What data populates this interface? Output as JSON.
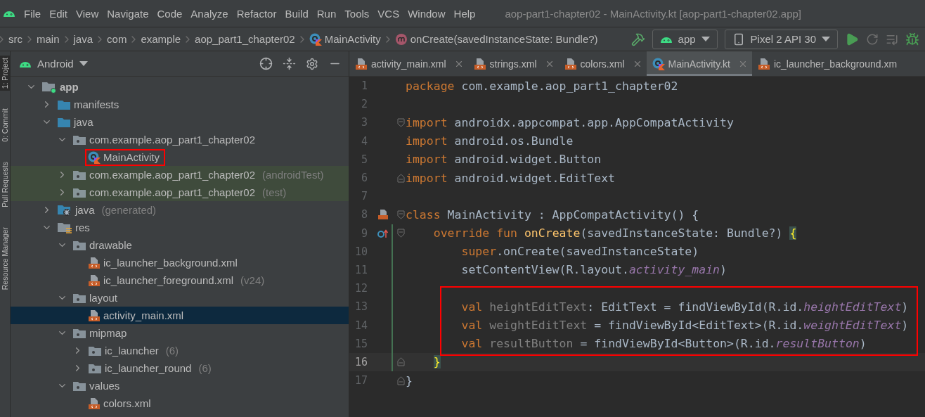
{
  "menu_bar": {
    "items": [
      "File",
      "Edit",
      "View",
      "Navigate",
      "Code",
      "Analyze",
      "Refactor",
      "Build",
      "Run",
      "Tools",
      "VCS",
      "Window",
      "Help"
    ],
    "title": "aop-part1-chapter02 - MainActivity.kt [aop-part1-chapter02.app]"
  },
  "breadcrumbs": [
    {
      "label": "src",
      "kind": "plain"
    },
    {
      "label": "main",
      "kind": "plain"
    },
    {
      "label": "java",
      "kind": "plain"
    },
    {
      "label": "com",
      "kind": "plain"
    },
    {
      "label": "example",
      "kind": "plain"
    },
    {
      "label": "aop_part1_chapter02",
      "kind": "plain"
    },
    {
      "label": "MainActivity",
      "kind": "class"
    },
    {
      "label": "onCreate(savedInstanceState: Bundle?)",
      "kind": "method"
    }
  ],
  "run_toolbar": {
    "configuration": "app",
    "device": "Pixel 2 API 30"
  },
  "tool_strip": [
    {
      "label": "1: Project",
      "selected": true
    },
    {
      "label": "0: Commit",
      "selected": false
    },
    {
      "label": "Pull Requests",
      "selected": false
    },
    {
      "label": "Resource Manager",
      "selected": false
    }
  ],
  "project_panel": {
    "view": "Android",
    "tree": [
      {
        "label": "app",
        "kind": "module",
        "expanded": true,
        "children": [
          {
            "label": "manifests",
            "kind": "folder",
            "expanded": false
          },
          {
            "label": "java",
            "kind": "folder",
            "expanded": true,
            "children": [
              {
                "label": "com.example.aop_part1_chapter02",
                "kind": "package",
                "expanded": true,
                "children": [
                  {
                    "label": "MainActivity",
                    "kind": "class",
                    "outlined": true
                  }
                ]
              },
              {
                "label": "com.example.aop_part1_chapter02",
                "note": "(androidTest)",
                "kind": "package",
                "expanded": false,
                "tinted": true
              },
              {
                "label": "com.example.aop_part1_chapter02",
                "note": "(test)",
                "kind": "package",
                "expanded": false,
                "tinted": true
              }
            ]
          },
          {
            "label": "java",
            "note": "(generated)",
            "kind": "generated",
            "expanded": false
          },
          {
            "label": "res",
            "kind": "res",
            "expanded": true,
            "children": [
              {
                "label": "drawable",
                "kind": "package",
                "expanded": true,
                "children": [
                  {
                    "label": "ic_launcher_background.xml",
                    "kind": "xml"
                  },
                  {
                    "label": "ic_launcher_foreground.xml",
                    "note": "(v24)",
                    "kind": "xml"
                  }
                ]
              },
              {
                "label": "layout",
                "kind": "package",
                "expanded": true,
                "children": [
                  {
                    "label": "activity_main.xml",
                    "kind": "xml",
                    "selected": true
                  }
                ]
              },
              {
                "label": "mipmap",
                "kind": "package",
                "expanded": true,
                "children": [
                  {
                    "label": "ic_launcher",
                    "note": "(6)",
                    "kind": "package",
                    "expanded": false
                  },
                  {
                    "label": "ic_launcher_round",
                    "note": "(6)",
                    "kind": "package",
                    "expanded": false
                  }
                ]
              },
              {
                "label": "values",
                "kind": "package",
                "expanded": true,
                "children": [
                  {
                    "label": "colors.xml",
                    "kind": "xml"
                  }
                ]
              }
            ]
          }
        ]
      }
    ]
  },
  "editor_tabs": [
    {
      "label": "activity_main.xml",
      "kind": "xml",
      "selected": false
    },
    {
      "label": "strings.xml",
      "kind": "xml",
      "selected": false
    },
    {
      "label": "colors.xml",
      "kind": "xml",
      "selected": false
    },
    {
      "label": "MainActivity.kt",
      "kind": "class",
      "selected": true
    },
    {
      "label": "ic_launcher_background.xm",
      "kind": "xml",
      "selected": false
    }
  ],
  "code_lines": [
    {
      "number": "1",
      "tokens": [
        {
          "t": "package",
          "kind": "keyword"
        },
        {
          "t": " com.example.aop_part1_chapter02",
          "kind": "plain"
        }
      ]
    },
    {
      "number": "2"
    },
    {
      "number": "3",
      "fold_start": true,
      "tokens": [
        {
          "t": "import",
          "kind": "keyword"
        },
        {
          "t": " androidx.appcompat.app.AppCompatActivity",
          "kind": "plain"
        }
      ]
    },
    {
      "number": "4",
      "tokens": [
        {
          "t": "import",
          "kind": "keyword"
        },
        {
          "t": " android.os.Bundle",
          "kind": "plain"
        }
      ]
    },
    {
      "number": "5",
      "tokens": [
        {
          "t": "import",
          "kind": "keyword"
        },
        {
          "t": " android.widget.Button",
          "kind": "plain"
        }
      ]
    },
    {
      "number": "6",
      "fold_end": true,
      "tokens": [
        {
          "t": "import",
          "kind": "keyword"
        },
        {
          "t": " android.widget.EditText",
          "kind": "plain"
        }
      ]
    },
    {
      "number": "7"
    },
    {
      "number": "8",
      "fold_start": true,
      "kind": "class",
      "tokens": [
        {
          "t": "class",
          "kind": "keyword"
        },
        {
          "t": " MainActivity : AppCompatActivity() {",
          "kind": "plain"
        }
      ]
    },
    {
      "number": "9",
      "fold_start": true,
      "kind": "override",
      "changed": true,
      "tokens": [
        {
          "t": "    override fun ",
          "kind": "keyword"
        },
        {
          "t": "onCreate",
          "kind": "function"
        },
        {
          "t": "(savedInstanceState: Bundle?) ",
          "kind": "plain"
        },
        {
          "t": "{",
          "kind": "brace"
        }
      ]
    },
    {
      "number": "10",
      "changed": true,
      "tokens": [
        {
          "t": "        super",
          "kind": "keyword"
        },
        {
          "t": ".onCreate(savedInstanceState)",
          "kind": "plain"
        }
      ]
    },
    {
      "number": "11",
      "changed": true,
      "tokens": [
        {
          "t": "        setContentView(R.layout.",
          "kind": "plain"
        },
        {
          "t": "activity_main",
          "kind": "field"
        },
        {
          "t": ")",
          "kind": "plain"
        }
      ]
    },
    {
      "number": "12",
      "changed": true,
      "boxed": true
    },
    {
      "number": "13",
      "changed": true,
      "boxed": true,
      "tokens": [
        {
          "t": "        val",
          "kind": "keyword"
        },
        {
          "t": " heightEditText",
          "kind": "unused"
        },
        {
          "t": ": EditText = findViewById(R.id.",
          "kind": "plain"
        },
        {
          "t": "heightEditText",
          "kind": "field"
        },
        {
          "t": ")",
          "kind": "plain"
        }
      ]
    },
    {
      "number": "14",
      "changed": true,
      "boxed": true,
      "tokens": [
        {
          "t": "        val",
          "kind": "keyword"
        },
        {
          "t": " weightEditText",
          "kind": "unused"
        },
        {
          "t": " = findViewById<EditText>(R.id.",
          "kind": "plain"
        },
        {
          "t": "weightEditText",
          "kind": "field"
        },
        {
          "t": ")",
          "kind": "plain"
        }
      ]
    },
    {
      "number": "15",
      "changed": true,
      "boxed": true,
      "tokens": [
        {
          "t": "        val",
          "kind": "keyword"
        },
        {
          "t": " resultButton",
          "kind": "unused"
        },
        {
          "t": " = findViewById<Button>(R.id.",
          "kind": "plain"
        },
        {
          "t": "resultButton",
          "kind": "field"
        },
        {
          "t": ")",
          "kind": "plain"
        }
      ]
    },
    {
      "number": "16",
      "fold_end": true,
      "current": true,
      "changed": true,
      "tokens": [
        {
          "t": "    }",
          "kind": "brace"
        }
      ]
    },
    {
      "number": "17",
      "fold_end": true,
      "tokens": [
        {
          "t": "}",
          "kind": "plain"
        }
      ]
    }
  ]
}
